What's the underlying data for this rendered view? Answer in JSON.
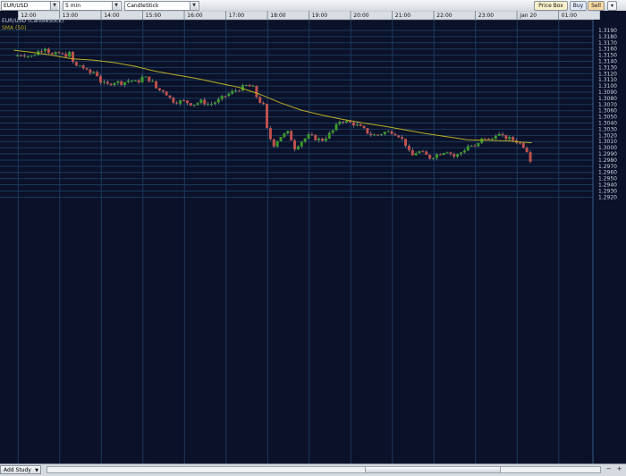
{
  "toolbar": {
    "symbol": "EUR/USD",
    "interval": "5 min",
    "chart_style": "CandleStick",
    "price_box_label": "Price Box",
    "buy_label": "Buy",
    "sell_label": "Sell"
  },
  "legend": {
    "instrument_label": "EUR/USD (CandleStick)",
    "study_label": "SMA (50)"
  },
  "footer": {
    "add_study_label": "Add Study",
    "zoom_out_label": "−",
    "zoom_in_label": "+"
  },
  "colors": {
    "background": "#0a1128",
    "grid": "#1c3a5e",
    "up_candle": "#3a9a2a",
    "down_candle": "#c0504d",
    "sma": "#b8ad22"
  },
  "chart_data": {
    "type": "candlestick",
    "title": "EUR/USD (CandleStick)",
    "interval_minutes": 5,
    "x_ticks": [
      "12:00",
      "13:00",
      "14:00",
      "15:00",
      "16:00",
      "17:00",
      "18:00",
      "19:00",
      "20:00",
      "21:00",
      "22:00",
      "23:00",
      "Jan 20",
      "01:00"
    ],
    "y_ticks": [
      "1.3190",
      "1.3180",
      "1.3170",
      "1.3160",
      "1.3150",
      "1.3140",
      "1.3130",
      "1.3120",
      "1.3110",
      "1.3100",
      "1.3090",
      "1.3080",
      "1.3070",
      "1.3060",
      "1.3050",
      "1.3040",
      "1.3030",
      "1.3020",
      "1.3010",
      "1.3000",
      "1.2990",
      "1.2980",
      "1.2970",
      "1.2960",
      "1.2950",
      "1.2940",
      "1.2930",
      "1.2920"
    ],
    "ylim": [
      1.292,
      1.319
    ],
    "grid": true,
    "close_path": [
      [
        11.9,
        1.3148
      ],
      [
        12.1,
        1.3152
      ],
      [
        12.3,
        1.3147
      ],
      [
        12.5,
        1.3157
      ],
      [
        12.65,
        1.3163
      ],
      [
        12.8,
        1.315
      ],
      [
        13.0,
        1.3153
      ],
      [
        13.1,
        1.3149
      ],
      [
        13.25,
        1.3153
      ],
      [
        13.35,
        1.3131
      ],
      [
        13.5,
        1.3134
      ],
      [
        13.7,
        1.312
      ],
      [
        13.85,
        1.3124
      ],
      [
        14.0,
        1.3105
      ],
      [
        14.15,
        1.3102
      ],
      [
        14.3,
        1.3107
      ],
      [
        14.5,
        1.3105
      ],
      [
        14.7,
        1.311
      ],
      [
        14.85,
        1.3105
      ],
      [
        15.0,
        1.3115
      ],
      [
        15.2,
        1.3109
      ],
      [
        15.35,
        1.3093
      ],
      [
        15.5,
        1.3093
      ],
      [
        15.7,
        1.3076
      ],
      [
        15.8,
        1.3075
      ],
      [
        16.0,
        1.3075
      ],
      [
        16.2,
        1.307
      ],
      [
        16.4,
        1.3075
      ],
      [
        16.6,
        1.307
      ],
      [
        16.8,
        1.3076
      ],
      [
        17.0,
        1.3085
      ],
      [
        17.2,
        1.3092
      ],
      [
        17.4,
        1.3098
      ],
      [
        17.5,
        1.3101
      ],
      [
        17.65,
        1.3097
      ],
      [
        17.75,
        1.308
      ],
      [
        17.9,
        1.3068
      ],
      [
        18.0,
        1.3022
      ],
      [
        18.15,
        1.3005
      ],
      [
        18.3,
        1.3018
      ],
      [
        18.5,
        1.3025
      ],
      [
        18.65,
        1.3
      ],
      [
        18.8,
        1.301
      ],
      [
        19.0,
        1.302
      ],
      [
        19.15,
        1.3015
      ],
      [
        19.3,
        1.3012
      ],
      [
        19.45,
        1.302
      ],
      [
        19.6,
        1.303
      ],
      [
        19.75,
        1.3045
      ],
      [
        19.9,
        1.3042
      ],
      [
        20.1,
        1.3038
      ],
      [
        20.3,
        1.303
      ],
      [
        20.45,
        1.3022
      ],
      [
        20.6,
        1.302
      ],
      [
        20.8,
        1.3025
      ],
      [
        21.0,
        1.3026
      ],
      [
        21.15,
        1.302
      ],
      [
        21.3,
        1.3008
      ],
      [
        21.45,
        1.2985
      ],
      [
        21.6,
        1.2995
      ],
      [
        21.75,
        1.299
      ],
      [
        21.9,
        1.2984
      ],
      [
        22.1,
        1.299
      ],
      [
        22.3,
        1.2996
      ],
      [
        22.5,
        1.2985
      ],
      [
        22.7,
        1.2995
      ],
      [
        22.85,
        1.3005
      ],
      [
        23.0,
        1.3
      ],
      [
        23.2,
        1.3018
      ],
      [
        23.35,
        1.301
      ],
      [
        23.5,
        1.3024
      ],
      [
        23.65,
        1.3017
      ],
      [
        23.8,
        1.3015
      ],
      [
        24.0,
        1.301
      ],
      [
        24.15,
        1.3003
      ],
      [
        24.3,
        1.299
      ],
      [
        24.35,
        1.2962
      ]
    ],
    "sma_path": [
      [
        11.9,
        1.3158
      ],
      [
        12.3,
        1.3155
      ],
      [
        12.8,
        1.315
      ],
      [
        13.3,
        1.3144
      ],
      [
        13.8,
        1.3142
      ],
      [
        14.3,
        1.3138
      ],
      [
        14.8,
        1.3132
      ],
      [
        15.3,
        1.3124
      ],
      [
        15.8,
        1.3118
      ],
      [
        16.3,
        1.3112
      ],
      [
        16.8,
        1.3105
      ],
      [
        17.3,
        1.3098
      ],
      [
        17.8,
        1.3087
      ],
      [
        18.3,
        1.3073
      ],
      [
        18.8,
        1.3061
      ],
      [
        19.3,
        1.3053
      ],
      [
        19.8,
        1.3046
      ],
      [
        20.3,
        1.304
      ],
      [
        20.8,
        1.3035
      ],
      [
        21.3,
        1.3029
      ],
      [
        21.8,
        1.3023
      ],
      [
        22.3,
        1.3018
      ],
      [
        22.8,
        1.3013
      ],
      [
        23.3,
        1.3012
      ],
      [
        23.8,
        1.3011
      ],
      [
        24.1,
        1.3009
      ],
      [
        24.35,
        1.3008
      ]
    ]
  }
}
